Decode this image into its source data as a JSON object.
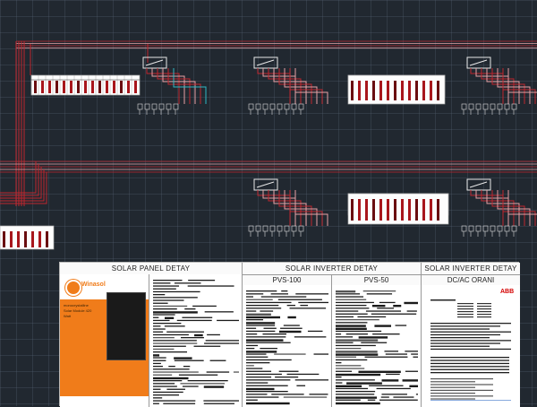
{
  "colors": {
    "background": "#212830",
    "wire_red": "#c0262e",
    "wire_pink": "#e8a0a4",
    "wire_cyan": "#2fb7c4",
    "accent_orange": "#f07c1a",
    "abb_red": "#d40000"
  },
  "details_table": {
    "solar_panel_title": "SOLAR PANEL DETAY",
    "solar_inverter_title": "SOLAR INVERTER DETAY",
    "solar_inverter_title_2": "SOLAR INVERTER DETAY",
    "pvs100_label": "PVS-100",
    "pvs50_label": "PVS-50",
    "dcac_label": "DC/AC ORANI"
  },
  "brochure": {
    "brand": "Winasol",
    "tagline_1": "monocrystalline",
    "tagline_2": "Solar Module 420",
    "tagline_3": "Watt",
    "abb": "ABB"
  }
}
